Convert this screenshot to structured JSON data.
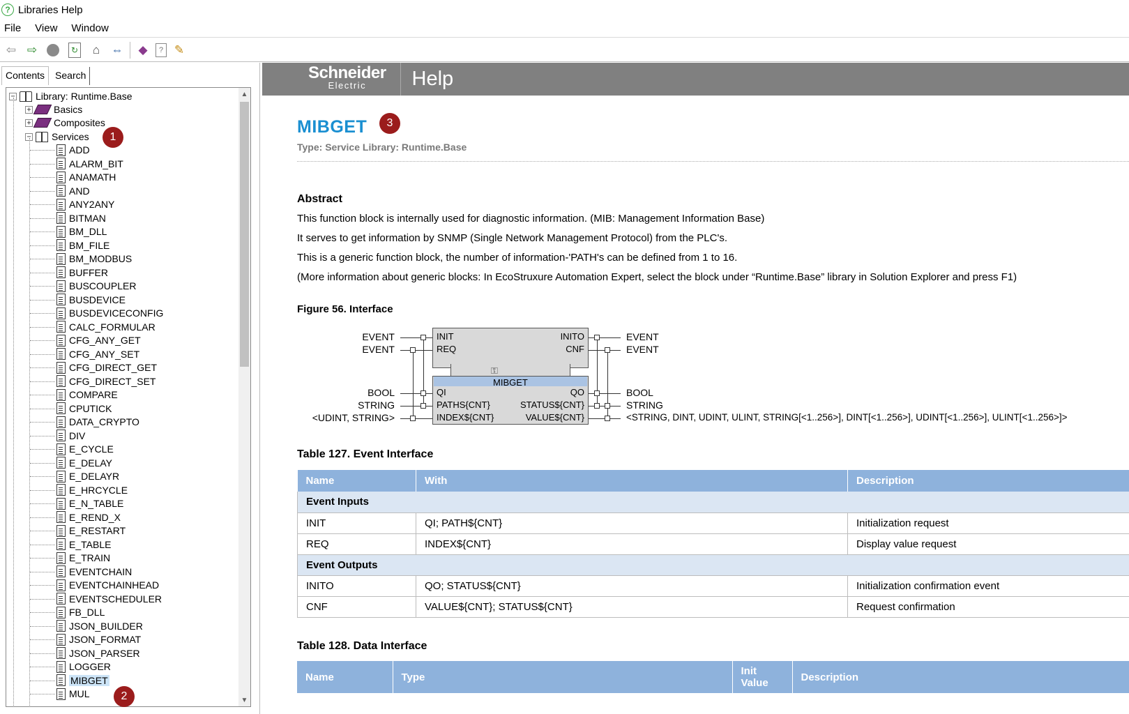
{
  "window": {
    "title": "Libraries Help",
    "app_icon": "help-question-icon"
  },
  "menu": [
    "File",
    "View",
    "Window"
  ],
  "toolbar": {
    "buttons": [
      "back-arrow-icon",
      "forward-arrow-icon",
      "stop-icon",
      "refresh-icon",
      "home-icon",
      "sync-icon",
      "book-icon",
      "page-icon",
      "options-icon"
    ]
  },
  "left": {
    "tabs": [
      "Contents",
      "Search"
    ],
    "root": "Library: Runtime.Base",
    "folders": [
      "Basics",
      "Composites",
      "Services"
    ],
    "items": [
      "ADD",
      "ALARM_BIT",
      "ANAMATH",
      "AND",
      "ANY2ANY",
      "BITMAN",
      "BM_DLL",
      "BM_FILE",
      "BM_MODBUS",
      "BUFFER",
      "BUSCOUPLER",
      "BUSDEVICE",
      "BUSDEVICECONFIG",
      "CALC_FORMULAR",
      "CFG_ANY_GET",
      "CFG_ANY_SET",
      "CFG_DIRECT_GET",
      "CFG_DIRECT_SET",
      "COMPARE",
      "CPUTICK",
      "DATA_CRYPTO",
      "DIV",
      "E_CYCLE",
      "E_DELAY",
      "E_DELAYR",
      "E_HRCYCLE",
      "E_N_TABLE",
      "E_REND_X",
      "E_RESTART",
      "E_TABLE",
      "E_TRAIN",
      "EVENTCHAIN",
      "EVENTCHAINHEAD",
      "EVENTSCHEDULER",
      "FB_DLL",
      "JSON_BUILDER",
      "JSON_FORMAT",
      "JSON_PARSER",
      "LOGGER",
      "MIBGET",
      "MUL"
    ],
    "selected": "MIBGET"
  },
  "badges": {
    "b1": "1",
    "b2": "2",
    "b3": "3",
    "color": "#9b1c1c"
  },
  "header": {
    "brand_main": "Schneider",
    "brand_sub": "Electric",
    "title": "Help"
  },
  "doc": {
    "title": "MIBGET",
    "type": "Type: Service Library: Runtime.Base",
    "abstract_heading": "Abstract",
    "abstract": [
      "This function block is internally used for diagnostic information. (MIB: Management Information Base)",
      "It serves to get information by SNMP (Single Network Management Protocol) from the PLC's.",
      "This is a generic function block, the number of information-'PATH's can be defined from 1 to 16.",
      "(More information about generic blocks: In EcoStruxure Automation Expert, select the block under “Runtime.Base” library in Solution Explorer and press F1)"
    ],
    "figure_caption": "Figure 56. Interface",
    "fb": {
      "name": "MIBGET",
      "ev_in": [
        "INIT",
        "REQ"
      ],
      "ev_out": [
        "INITO",
        "CNF"
      ],
      "data_in": [
        "QI",
        "PATHS{CNT}",
        "INDEX${CNT}"
      ],
      "data_out": [
        "QO",
        "STATUS${CNT}",
        "VALUE${CNT}"
      ],
      "ev_in_types": [
        "EVENT",
        "EVENT"
      ],
      "ev_out_types": [
        "EVENT",
        "EVENT"
      ],
      "data_in_types": [
        "BOOL",
        "STRING",
        "<UDINT, STRING>"
      ],
      "data_out_types": [
        "BOOL",
        "STRING",
        "<STRING, DINT, UDINT, ULINT, STRING[<1..256>], DINT[<1..256>], UDINT[<1..256>], ULINT[<1..256>]>"
      ]
    },
    "table127": {
      "caption": "Table 127. Event Interface",
      "headers": [
        "Name",
        "With",
        "Description"
      ],
      "group_inputs": "Event Inputs",
      "group_outputs": "Event Outputs",
      "inputs": [
        [
          "INIT",
          "QI; PATH${CNT}",
          "Initialization request"
        ],
        [
          "REQ",
          "INDEX${CNT}",
          "Display value request"
        ]
      ],
      "outputs": [
        [
          "INITO",
          "QO; STATUS${CNT}",
          "Initialization confirmation event"
        ],
        [
          "CNF",
          "VALUE${CNT}; STATUS${CNT}",
          "Request confirmation"
        ]
      ]
    },
    "table128": {
      "caption": "Table 128. Data Interface",
      "headers": [
        "Name",
        "Type",
        "Init Value",
        "Description"
      ]
    }
  },
  "colors": {
    "accent_title": "#1a8fd1",
    "table_header": "#8eb2dc",
    "group_row": "#dbe6f3",
    "header_bar": "#808080"
  }
}
